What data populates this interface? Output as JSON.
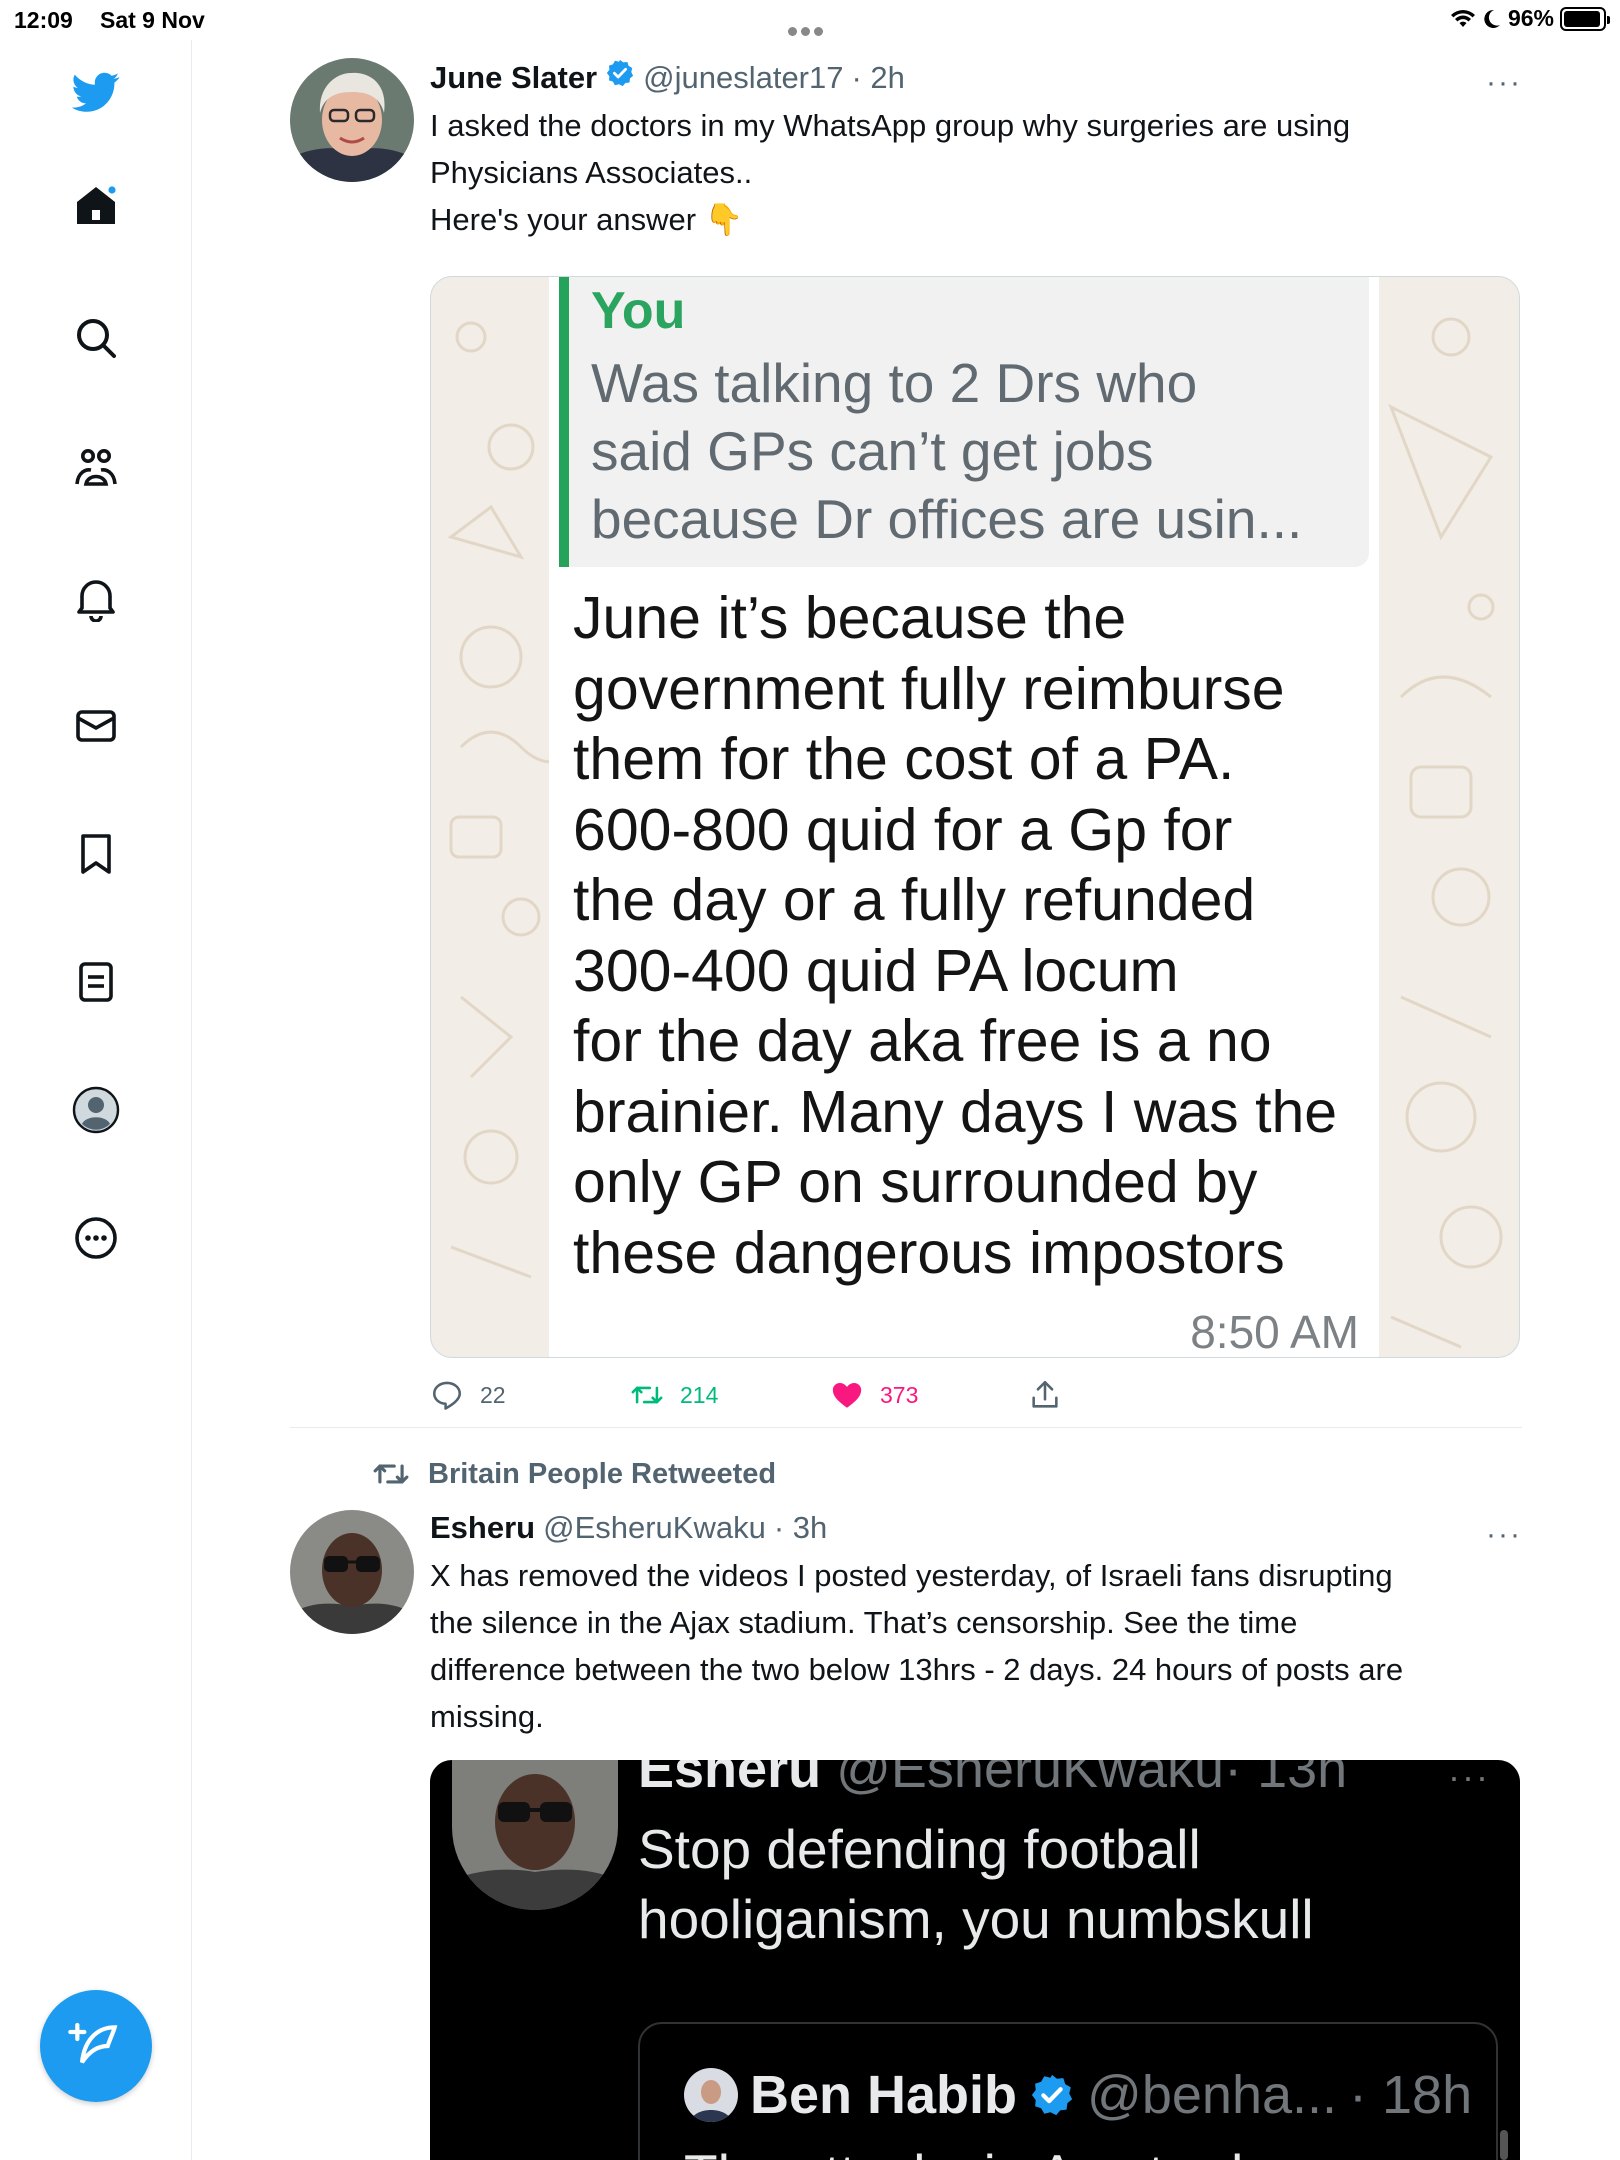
{
  "status_bar": {
    "time": "12:09",
    "date": "Sat 9 Nov",
    "battery": "96%",
    "battery_level": 0.96
  },
  "sidebar": {
    "items": [
      "twitter-logo",
      "home",
      "explore",
      "communities",
      "notifications",
      "messages",
      "bookmarks",
      "lists",
      "profile",
      "more"
    ],
    "compose_icon": "compose-icon"
  },
  "tweet1": {
    "name": "June Slater",
    "handle": "@juneslater17",
    "time": "· 2h",
    "more": "···",
    "text_lines": [
      "I asked the doctors in my WhatsApp group why surgeries are using",
      "Physicians Associates..",
      "Here's your answer 👇"
    ],
    "media": {
      "quote_author": "You",
      "quote_lines": [
        "Was talking to 2 Drs who",
        "said GPs can’t get jobs",
        "because Dr offices are usin..."
      ],
      "message_lines": [
        "June it’s because the",
        "government fully reimburse",
        "them for the cost of a PA.",
        "600-800 quid for a Gp for",
        "the day or a fully refunded",
        "300-400 quid PA locum",
        "for the day aka free is a no",
        "brainier. Many days I was the",
        "only GP on surrounded by",
        "these dangerous impostors"
      ],
      "time": "8:50 AM"
    },
    "replies": "22",
    "retweets": "214",
    "likes": "373"
  },
  "tweet2": {
    "retweeted_by": "Britain People Retweeted",
    "name": "Esheru",
    "handle": "@EsheruKwaku",
    "time": "· 3h",
    "more": "···",
    "text_lines": [
      "X has removed the videos  I posted yesterday, of Israeli fans disrupting",
      "the silence in the Ajax stadium. That’s censorship. See the time",
      "difference between the two below 13hrs - 2 days. 24 hours of posts are",
      "missing."
    ],
    "media": {
      "name": "Esheru",
      "handle": "@EsheruKwaku",
      "time": "· 13h",
      "more": "···",
      "text_lines": [
        "Stop defending football",
        "hooliganism, you numbskull"
      ],
      "quoted": {
        "name": "Ben Habib",
        "handle": "@benha...",
        "time": "· 18h",
        "text": "The attacks in Amsterdam on"
      }
    }
  },
  "colors": {
    "twitter_blue": "#1d9bf0",
    "like_pink": "#f91880",
    "retweet_green": "#00ba7c",
    "whatsapp_green": "#25a35a"
  }
}
